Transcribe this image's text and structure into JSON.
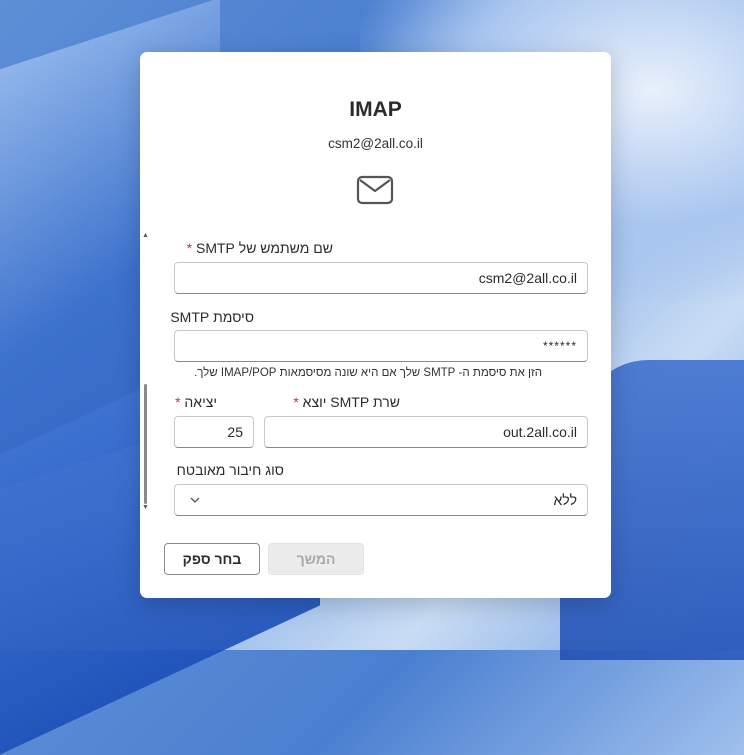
{
  "dialog": {
    "title": "IMAP",
    "account_email": "csm2@2all.co.il",
    "icon": "envelope-icon"
  },
  "form": {
    "smtp_username": {
      "label": "שם משתמש של SMTP",
      "required_mark": "*",
      "value": "csm2@2all.co.il"
    },
    "smtp_password": {
      "label": "סיסמת SMTP",
      "value": "******",
      "hint": "הזן את סיסמת ה- SMTP שלך אם היא שונה מסיסמאות IMAP/POP שלך."
    },
    "outgoing_server": {
      "label": "שרת SMTP יוצא",
      "required_mark": "*",
      "value": "out.2all.co.il"
    },
    "port": {
      "label": "יציאה",
      "required_mark": "*",
      "value": "25"
    },
    "secure_connection": {
      "label": "סוג חיבור מאובטח",
      "selected": "ללא"
    }
  },
  "buttons": {
    "choose_provider": "בחר ספק",
    "continue": "המשך"
  }
}
